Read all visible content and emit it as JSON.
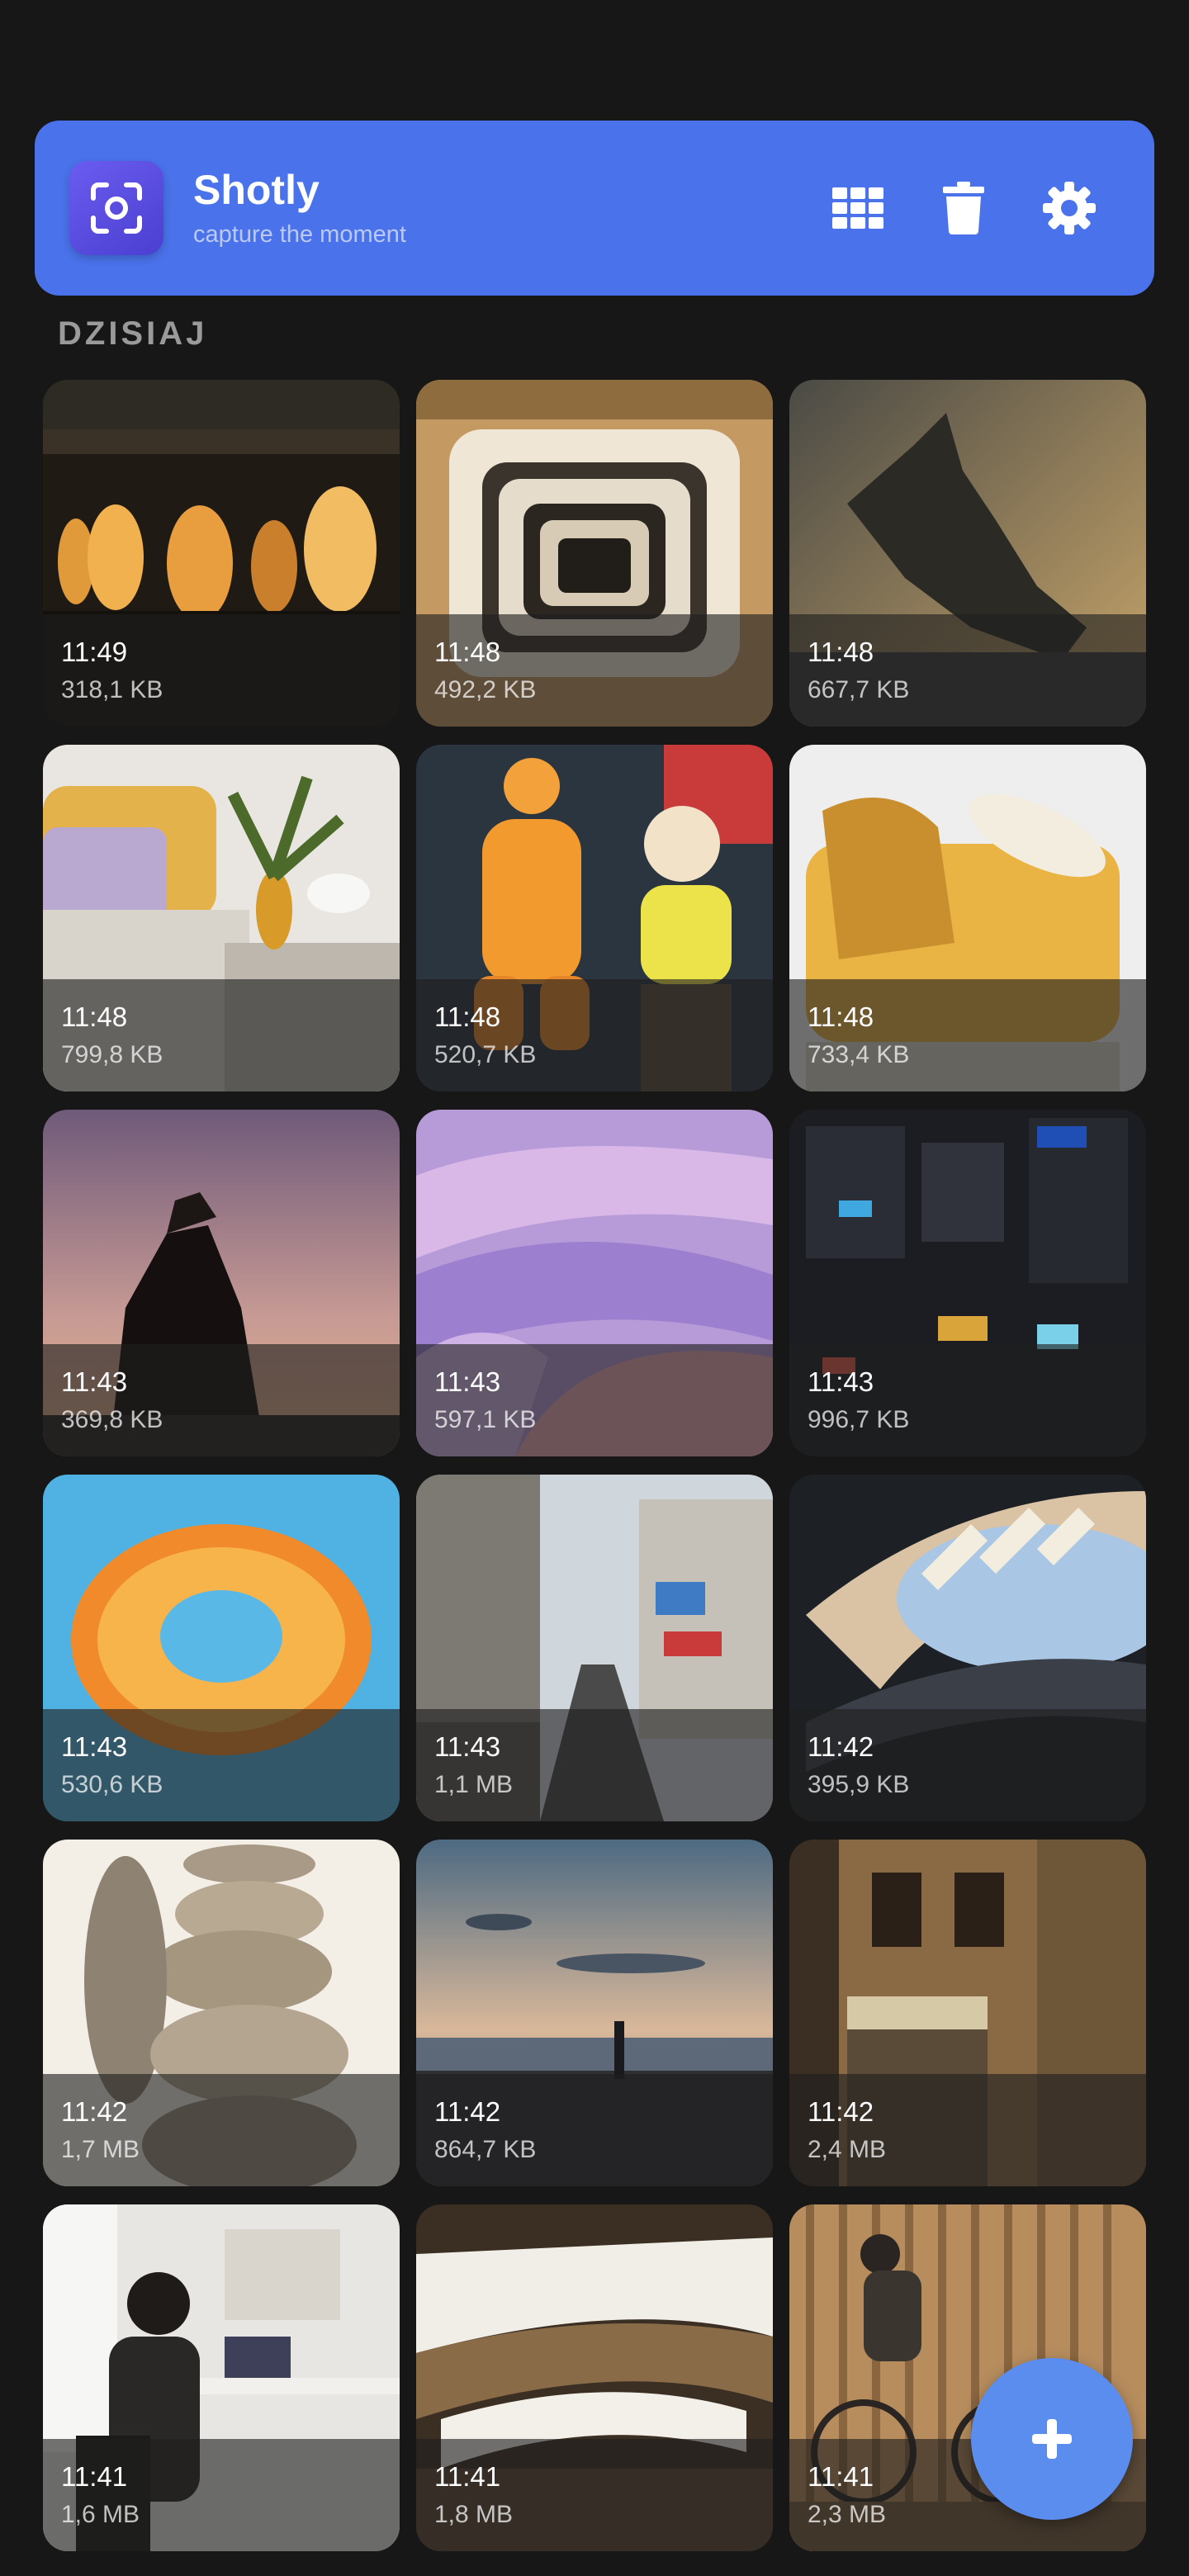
{
  "header": {
    "title": "Shotly",
    "subtitle": "capture the moment",
    "actions": [
      "grid-view-icon",
      "trash-icon",
      "gear-icon"
    ],
    "accent": "#4a72ea"
  },
  "section": {
    "label": "DZISIAJ"
  },
  "screenshots": [
    {
      "time": "11:49",
      "size": "318,1 KB"
    },
    {
      "time": "11:48",
      "size": "492,2 KB"
    },
    {
      "time": "11:48",
      "size": "667,7 KB"
    },
    {
      "time": "11:48",
      "size": "799,8 KB"
    },
    {
      "time": "11:48",
      "size": "520,7 KB"
    },
    {
      "time": "11:48",
      "size": "733,4 KB"
    },
    {
      "time": "11:43",
      "size": "369,8 KB"
    },
    {
      "time": "11:43",
      "size": "597,1 KB"
    },
    {
      "time": "11:43",
      "size": "996,7 KB"
    },
    {
      "time": "11:43",
      "size": "530,6 KB"
    },
    {
      "time": "11:43",
      "size": "1,1 MB"
    },
    {
      "time": "11:42",
      "size": "395,9 KB"
    },
    {
      "time": "11:42",
      "size": "1,7 MB"
    },
    {
      "time": "11:42",
      "size": "864,7 KB"
    },
    {
      "time": "11:42",
      "size": "2,4 MB"
    },
    {
      "time": "11:41",
      "size": "1,6 MB"
    },
    {
      "time": "11:41",
      "size": "1,8 MB"
    },
    {
      "time": "11:41",
      "size": "2,3 MB"
    }
  ],
  "fab": {
    "icon": "plus-icon",
    "color": "#5b8def"
  }
}
